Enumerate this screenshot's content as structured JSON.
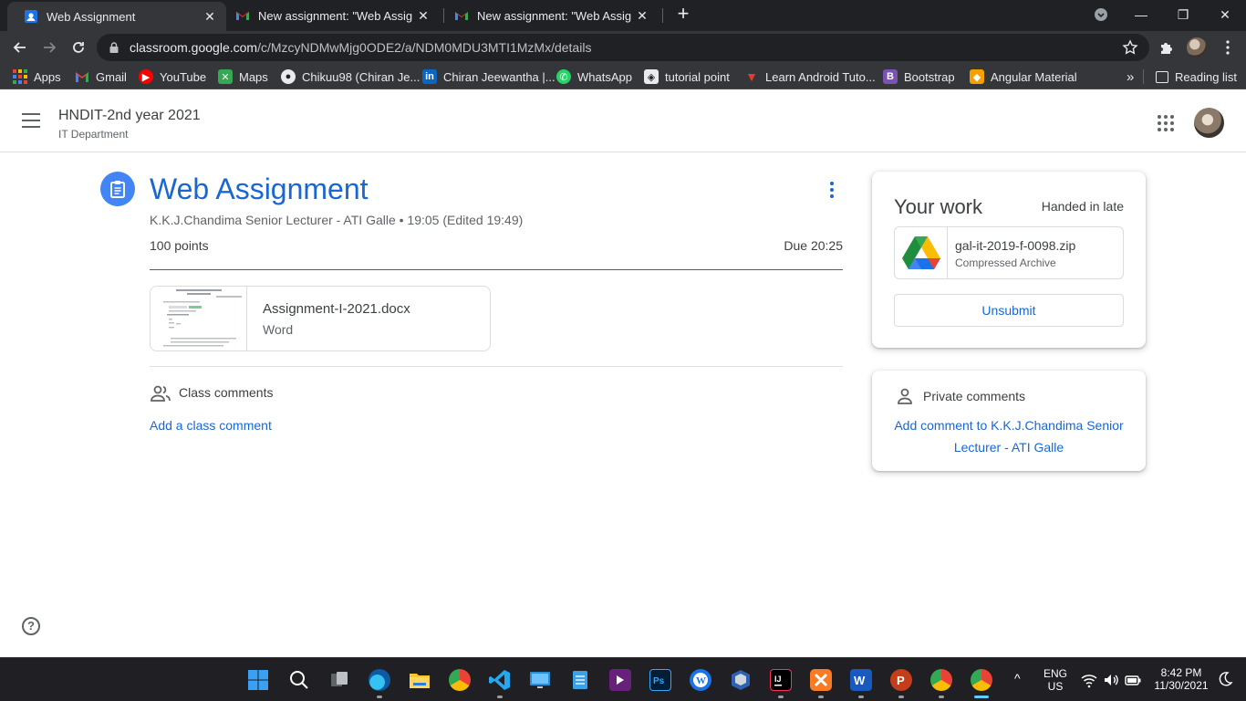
{
  "tabs": [
    {
      "title": "Web Assignment",
      "active": true
    },
    {
      "title": "New assignment: \"Web Assignme",
      "active": false
    },
    {
      "title": "New assignment: \"Web Assignme",
      "active": false
    }
  ],
  "window": {
    "close_tab": "✕",
    "new_tab": "+",
    "minimize": "—",
    "restore": "❐",
    "close": "✕"
  },
  "address": {
    "host": "classroom.google.com",
    "path": "/c/MzcyNDMwMjg0ODE2/a/NDM0MDU3MTI1MzMx/details"
  },
  "bookmarks": [
    {
      "label": "Apps",
      "icon": "apps-icon"
    },
    {
      "label": "Gmail",
      "icon": "gmail-icon"
    },
    {
      "label": "YouTube",
      "icon": "youtube-icon"
    },
    {
      "label": "Maps",
      "icon": "maps-icon"
    },
    {
      "label": "Chikuu98 (Chiran Je...",
      "icon": "github-icon"
    },
    {
      "label": "Chiran Jeewantha |...",
      "icon": "linkedin-icon"
    },
    {
      "label": "WhatsApp",
      "icon": "whatsapp-icon"
    },
    {
      "label": "tutorial point",
      "icon": "tutorialspoint-icon"
    },
    {
      "label": "Learn Android Tuto...",
      "icon": "android-tutorial-icon"
    },
    {
      "label": "Bootstrap",
      "icon": "bootstrap-icon"
    },
    {
      "label": "Angular Material",
      "icon": "angular-icon"
    }
  ],
  "reading_list": "Reading list",
  "bookmarks_more": "»",
  "header": {
    "class_name": "HNDIT-2nd year 2021",
    "section": "IT Department"
  },
  "assignment": {
    "title": "Web Assignment",
    "meta": "K.K.J.Chandima Senior Lecturer - ATI Galle • 19:05 (Edited 19:49)",
    "points": "100 points",
    "due": "Due 20:25",
    "attachment": {
      "name": "Assignment-I-2021.docx",
      "type": "Word"
    },
    "class_comments_label": "Class comments",
    "add_class_comment": "Add a class comment"
  },
  "your_work": {
    "heading": "Your work",
    "status": "Handed in late",
    "file": {
      "name": "gal-it-2019-f-0098.zip",
      "type": "Compressed Archive"
    },
    "unsubmit": "Unsubmit"
  },
  "private_comments": {
    "heading": "Private comments",
    "add_link": "Add comment to K.K.J.Chandima Senior Lecturer - ATI Galle"
  },
  "help": "?",
  "taskbar": {
    "lang_top": "ENG",
    "lang_bottom": "US",
    "time": "8:42 PM",
    "date": "11/30/2021",
    "overflow": "^"
  },
  "colors": {
    "accent": "#1967d2",
    "assignment_icon": "#4285f4",
    "chrome_dark": "#202124",
    "taskbar": "#1f1f24"
  }
}
